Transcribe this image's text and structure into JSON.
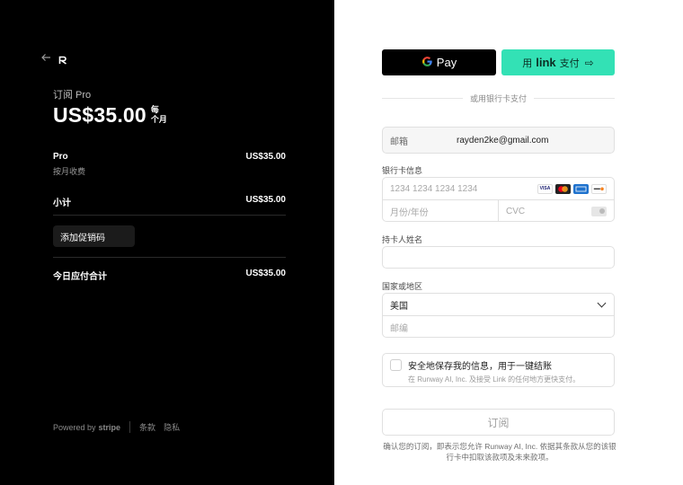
{
  "summary": {
    "product_label": "订阅 Pro",
    "price": "US$35.00",
    "period": [
      "每",
      "个月"
    ],
    "line_items": [
      {
        "name": "Pro",
        "desc": "按月收费",
        "amount": "US$35.00"
      }
    ],
    "subtotal_label": "小计",
    "subtotal_amount": "US$35.00",
    "promo_label": "添加促销码",
    "total_label": "今日应付合计",
    "total_amount": "US$35.00"
  },
  "footer": {
    "powered_by": "Powered by",
    "brand": "stripe",
    "terms": "条款",
    "privacy": "隐私"
  },
  "payment": {
    "gpay_label": "Pay",
    "link_prefix": "用",
    "link_brand": "link",
    "link_suffix": "支付",
    "or_text": "或用银行卡支付",
    "email_label": "邮箱",
    "email_value": "rayden2ke@gmail.com",
    "card_label": "银行卡信息",
    "card_number_placeholder": "1234 1234 1234 1234",
    "expiry_placeholder": "月份/年份",
    "cvc_placeholder": "CVC",
    "card_brands": [
      "VISA",
      "mastercard",
      "amex",
      "discover"
    ],
    "cardholder_label": "持卡人姓名",
    "cardholder_value": "",
    "country_label": "国家或地区",
    "country_value": "美国",
    "postal_placeholder": "邮编",
    "save_title": "安全地保存我的信息，用于一键结账",
    "save_desc": "在 Runway AI, Inc. 及接受 Link 的任何地方更快支付。",
    "subscribe_label": "订阅",
    "legal_text": "确认您的订阅，即表示您允许 Runway AI, Inc. 依据其条款从您的该银行卡中扣取该款项及未来款项。"
  },
  "colors": {
    "left_bg": "#000000",
    "link_green": "#33e1b5"
  },
  "icons": [
    "back-arrow-icon",
    "runway-logo",
    "google-g-icon",
    "arrow-right-icon",
    "chevron-down-icon",
    "cvc-card-icon"
  ]
}
